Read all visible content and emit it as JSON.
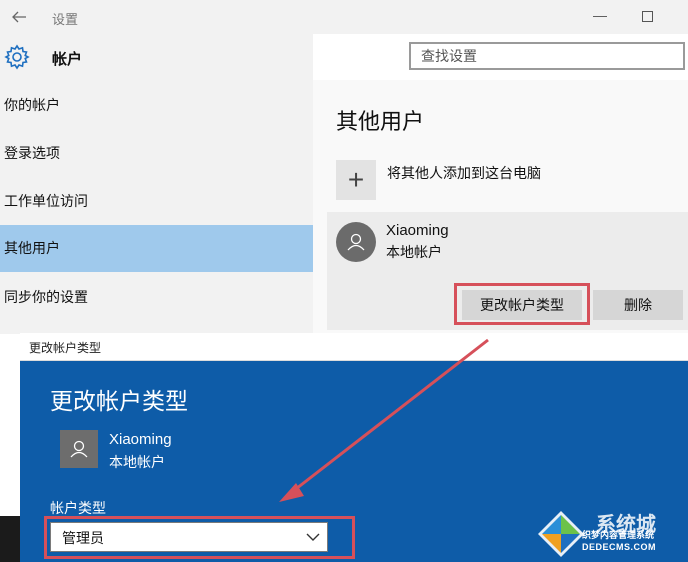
{
  "window": {
    "title": "设置",
    "back_icon": "back-arrow-icon"
  },
  "header": {
    "icon": "gear-icon",
    "label": "帐户"
  },
  "search": {
    "placeholder": "查找设置"
  },
  "sidebar": {
    "items": [
      {
        "label": "你的帐户",
        "selected": false
      },
      {
        "label": "登录选项",
        "selected": false
      },
      {
        "label": "工作单位访问",
        "selected": false
      },
      {
        "label": "其他用户",
        "selected": true
      },
      {
        "label": "同步你的设置",
        "selected": false
      }
    ]
  },
  "main": {
    "title": "其他用户",
    "add_label": "将其他人添加到这台电脑",
    "user": {
      "name": "Xiaoming",
      "type": "本地帐户"
    },
    "change_button": "更改帐户类型",
    "delete_button": "删除"
  },
  "dialog": {
    "window_title": "更改帐户类型",
    "heading": "更改帐户类型",
    "user": {
      "name": "Xiaoming",
      "type": "本地帐户"
    },
    "field_label": "帐户类型",
    "selected_value": "管理员"
  },
  "watermark": {
    "brand": "系统城",
    "site": "织梦内容管理系统",
    "domain": "DEDECMS.COM"
  },
  "colors": {
    "selected_nav": "#9fc9ec",
    "dialog_blue": "#0e5ca8",
    "highlight_red": "#d6505a"
  }
}
